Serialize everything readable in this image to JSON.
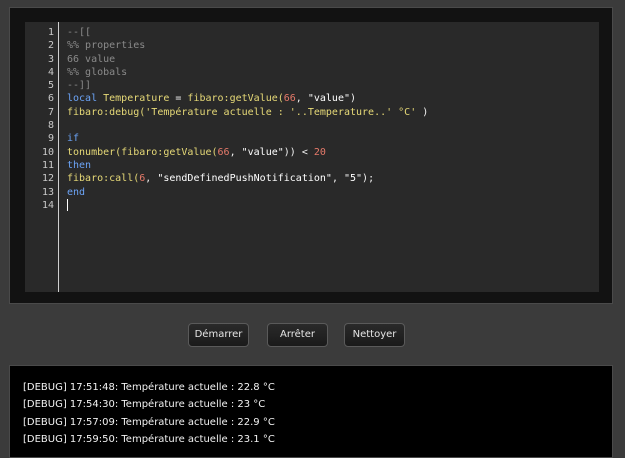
{
  "editor": {
    "line_numbers": [
      "1",
      "2",
      "3",
      "4",
      "5",
      "6",
      "7",
      "8",
      "9",
      "10",
      "11",
      "12",
      "13",
      "14"
    ],
    "lines": [
      [
        {
          "t": "--[[",
          "c": "comment"
        }
      ],
      [
        {
          "t": "%% properties",
          "c": "comment"
        }
      ],
      [
        {
          "t": "66 value",
          "c": "comment"
        }
      ],
      [
        {
          "t": "%% globals",
          "c": "comment"
        }
      ],
      [
        {
          "t": "--]]",
          "c": "comment"
        }
      ],
      [
        {
          "t": "local ",
          "c": "kw"
        },
        {
          "t": "Temperature",
          "c": "fn"
        },
        {
          "t": " = ",
          "c": "white"
        },
        {
          "t": "fibaro:getValue(",
          "c": "fn"
        },
        {
          "t": "66",
          "c": "num"
        },
        {
          "t": ", ",
          "c": "white"
        },
        {
          "t": "\"value\"",
          "c": "str"
        },
        {
          "t": ")",
          "c": "white"
        }
      ],
      [
        {
          "t": "fibaro:debug(",
          "c": "fn"
        },
        {
          "t": "'Température actuelle : '..",
          "c": "fn"
        },
        {
          "t": "Temperature",
          "c": "fn"
        },
        {
          "t": "..' °C' ",
          "c": "fn"
        },
        {
          "t": ")",
          "c": "white"
        }
      ],
      [],
      [
        {
          "t": "if",
          "c": "kw"
        }
      ],
      [
        {
          "t": "tonumber(fibaro:getValue(",
          "c": "fn"
        },
        {
          "t": "66",
          "c": "num"
        },
        {
          "t": ", ",
          "c": "white"
        },
        {
          "t": "\"value\"",
          "c": "str"
        },
        {
          "t": ")) < ",
          "c": "white"
        },
        {
          "t": "20",
          "c": "num"
        }
      ],
      [
        {
          "t": "then",
          "c": "kw"
        }
      ],
      [
        {
          "t": "fibaro:call(",
          "c": "fn"
        },
        {
          "t": "6",
          "c": "num"
        },
        {
          "t": ", ",
          "c": "white"
        },
        {
          "t": "\"sendDefinedPushNotification\"",
          "c": "str"
        },
        {
          "t": ", ",
          "c": "white"
        },
        {
          "t": "\"5\"",
          "c": "str"
        },
        {
          "t": ");",
          "c": "white"
        }
      ],
      [
        {
          "t": "end",
          "c": "kw"
        }
      ],
      []
    ]
  },
  "buttons": {
    "start": "Démarrer",
    "stop": "Arrêter",
    "clear": "Nettoyer"
  },
  "console": {
    "logs": [
      "[DEBUG] 17:51:48: Température actuelle : 22.8 °C",
      "[DEBUG] 17:54:30: Température actuelle : 23 °C",
      "[DEBUG] 17:57:09: Température actuelle : 22.9 °C",
      "[DEBUG] 17:59:50: Température actuelle : 23.1 °C"
    ]
  }
}
